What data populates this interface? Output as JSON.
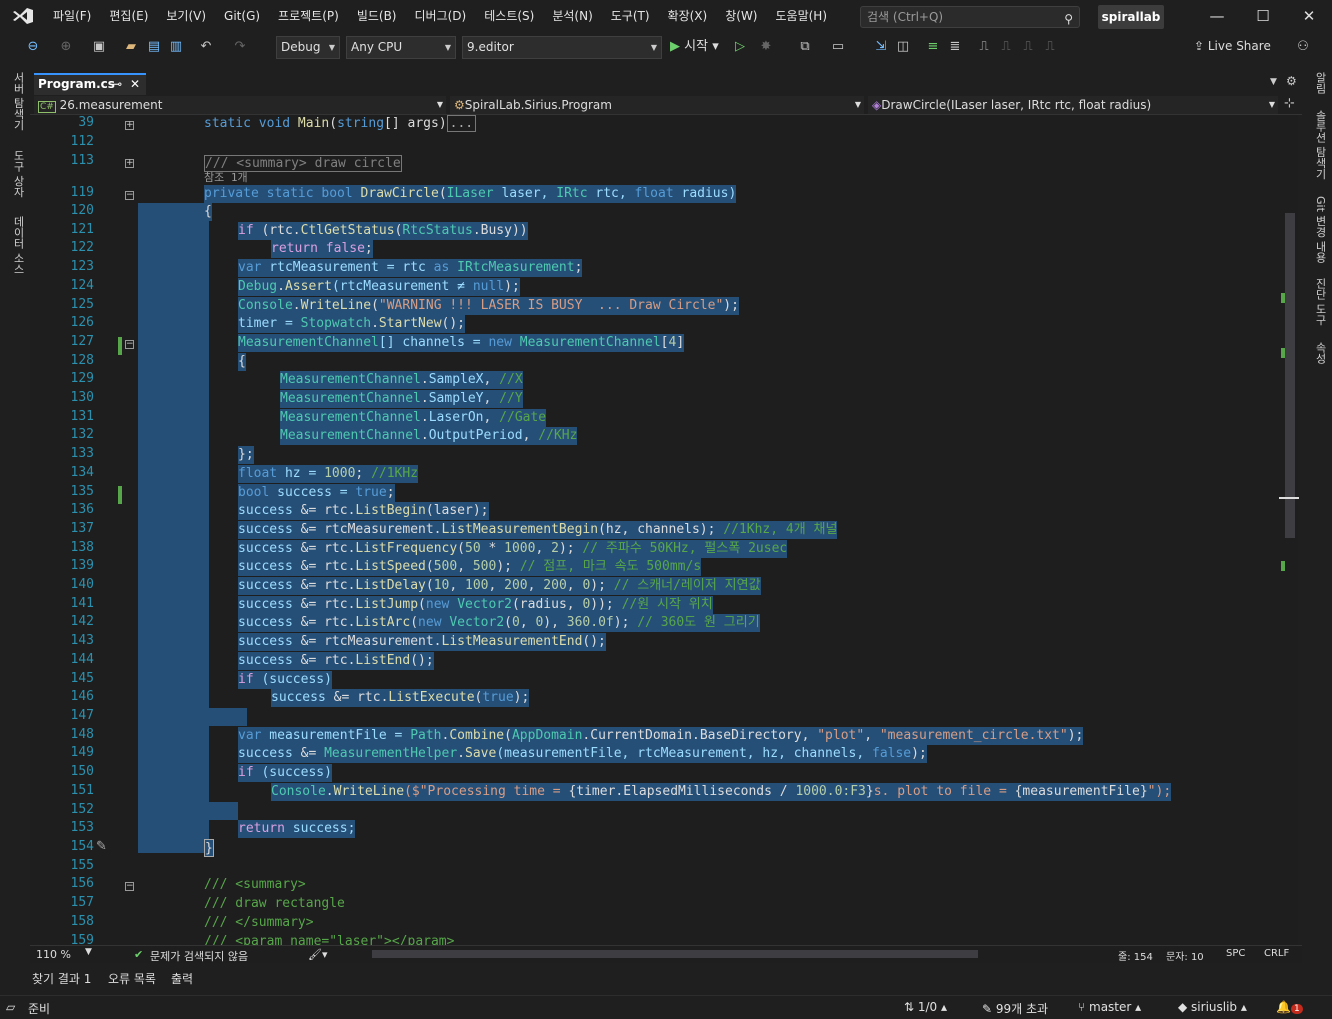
{
  "menu": [
    "파일(F)",
    "편집(E)",
    "보기(V)",
    "Git(G)",
    "프로젝트(P)",
    "빌드(B)",
    "디버그(D)",
    "테스트(S)",
    "분석(N)",
    "도구(T)",
    "확장(X)",
    "창(W)",
    "도움말(H)"
  ],
  "search": {
    "placeholder": "검색 (Ctrl+Q)"
  },
  "profile": "spirallab",
  "toolbar": {
    "config": "Debug",
    "platform": "Any CPU",
    "startup": "9.editor",
    "start": "시작",
    "liveshare": "Live Share"
  },
  "left_rail": [
    "서버 탐색기",
    "도구 상자",
    "데이터 소스"
  ],
  "right_rail": [
    "알림",
    "솔루션 탐색기",
    "Git 변경 내용",
    "진단 도구",
    "속성"
  ],
  "tab": {
    "name": "Program.cs"
  },
  "nav": {
    "project": "26.measurement",
    "class": "SpiralLab.Sirius.Program",
    "member": "DrawCircle(ILaser laser, IRtc rtc, float radius)"
  },
  "lines": [
    "39",
    "112",
    "113",
    "",
    "119",
    "120",
    "121",
    "122",
    "123",
    "124",
    "125",
    "126",
    "127",
    "128",
    "129",
    "130",
    "131",
    "132",
    "133",
    "134",
    "135",
    "136",
    "137",
    "138",
    "139",
    "140",
    "141",
    "142",
    "143",
    "144",
    "145",
    "146",
    "147",
    "148",
    "149",
    "150",
    "151",
    "152",
    "153",
    "154",
    "155",
    "156",
    "157",
    "158",
    "159"
  ],
  "code": {
    "l39a": "static void ",
    "l39b": "Main",
    "l39c": "(",
    "l39d": "string",
    "l39e": "[] args)",
    "l39f": "...",
    "l113": "/// <summary> draw circle",
    "ref": "참조 1개",
    "l119a": "private static bool ",
    "l119b": "DrawCircle",
    "l119c": "(",
    "l119d": "ILaser",
    "l119e": " laser, ",
    "l119f": "IRtc",
    "l119g": " rtc, ",
    "l119h": "float",
    "l119i": " radius)",
    "l120": "{",
    "l121a": "if",
    "l121b": " (rtc.",
    "l121c": "CtlGetStatus",
    "l121d": "(",
    "l121e": "RtcStatus",
    "l121f": ".Busy))",
    "l122a": "return false",
    ";": ";",
    "l123a": "var",
    "l123b": " rtcMeasurement = rtc ",
    "l123c": "as",
    "l123d": " ",
    "l123e": "IRtcMeasurement",
    "l124a": "Debug",
    "l124b": ".",
    "l124c": "Assert",
    "l124d": "(rtcMeasurement ≠ ",
    "l124e": "null",
    "l124f": ");",
    "l125a": "Console",
    "l125b": ".",
    "l125c": "WriteLine",
    "l125d": "(",
    "l125e": "\"WARNING !!! LASER IS BUSY  ... Draw Circle\"",
    "l125f": ");",
    "l126a": "timer = ",
    "l126b": "Stopwatch",
    "l126c": ".",
    "l126d": "StartNew",
    "l126e": "();",
    "l127a": "MeasurementChannel",
    "l127b": "[] channels = ",
    "l127c": "new",
    "l127d": " ",
    "l127e": "MeasurementChannel",
    "l127f": "[",
    "l127g": "4",
    "l127h": "]",
    "l128": "{",
    "ch1": "SampleX",
    "cm1": "//X",
    "ch2": "SampleY",
    "cm2": "//Y",
    "ch3": "LaserOn",
    "cm3": "//Gate",
    "ch4": "OutputPeriod",
    "cm4": "//KHz",
    "mc": "MeasurementChannel",
    "l133": "};",
    "l134a": "float",
    "l134b": " hz = ",
    "l134c": "1000",
    "l134d": "; ",
    "l134e": "//1KHz",
    "l135a": "bool",
    "l135b": " success = ",
    "l135c": "true",
    "l136": "ListBegin",
    "l137a": "rtcMeasurement.",
    "l137b": "ListMeasurementBegin",
    "l137c": "(hz, channels); ",
    "l137d": "//1Khz, 4개 채널",
    "l138a": "ListFrequency",
    "l138b": "50",
    "l138c": " * ",
    "l138d": "1000",
    "l138e": ", ",
    "l138f": "2",
    "l138g": "); ",
    "l138h": "// 주파수 50KHz, 펄스폭 2usec",
    "l139a": "ListSpeed",
    "l139b": "500",
    "l139c": "500",
    "l139d": "// 점프, 마크 속도 500mm/s",
    "l140a": "ListDelay",
    "l140b": "10",
    "l140c": "100",
    "l140d": "200",
    "l140e": "200",
    "l140f": "0",
    "l140g": "// 스캐너/레이저 지연값",
    "l141a": "ListJump",
    "l141b": "new",
    "l141c": "Vector2",
    "l141d": "(radius, ",
    "l141e": "0",
    "l141f": ")); ",
    "l141g": "//원 시작 위치",
    "l142a": "ListArc",
    "l142b": "360.0f",
    "l142c": "// 360도 원 그리기",
    "l143": "ListMeasurementEnd",
    "l144": "ListEnd",
    "l145": "(success)",
    "l146": "ListExecute",
    "l148a": "var",
    "l148b": " measurementFile = ",
    "l148c": "Path",
    "l148d": "Combine",
    "l148e": "AppDomain",
    "l148f": "CurrentDomain",
    "l148g": "BaseDirectory",
    "l148h": "\"plot\"",
    "l148i": "\"measurement_circle.txt\"",
    "l149a": "MeasurementHelper",
    "l149b": "Save",
    "l149c": "(measurementFile, rtcMeasurement, hz, channels, ",
    "l149d": "false",
    "l149e": ");",
    "l151a": "Console",
    "l151b": "WriteLine",
    "l151c": "($\"Processing time = ",
    "l151d": "{timer.ElapsedMilliseconds / ",
    "l151e": "1000.0:F3",
    "l151f": "}",
    "l151g": "s. plot to file = ",
    "l151h": "{measurementFile}",
    "l151i": "\");",
    "l153a": "return",
    "l153b": " success;",
    "l154": "}",
    "l156": "/// <summary>",
    "l157": "/// draw rectangle",
    "l158": "/// </summary>",
    "l159": "/// <param name=\"laser\"></param>",
    "succ": "success",
    "andeq": " &= ",
    "rtcdot": "rtc.",
    "true": "true",
    "semi": ";",
    "commasp": ", ",
    "lp": "(",
    "rp": ")",
    "dot": ".",
    "sp": " ",
    "ifkw": "if",
    "zero": "0",
    "rpsemi": ");",
    "vec": "Vector2",
    "newkw": "new",
    "laserarg": "(laser);",
    "emptycall": "();",
    "comma": ","
  },
  "status": {
    "zoom": "110 %",
    "issues": "문제가 검색되지 않음",
    "line": "줄: 154",
    "col": "문자: 10",
    "spc": "SPC",
    "crlf": "CRLF"
  },
  "bottom_tabs": [
    "찾기 결과 1",
    "오류 목록",
    "출력"
  ],
  "statusbar": {
    "ready": "준비",
    "updown": "1/0",
    "changes": "99개 초과",
    "branch": "master",
    "repo": "siriuslib",
    "notif": "1"
  }
}
